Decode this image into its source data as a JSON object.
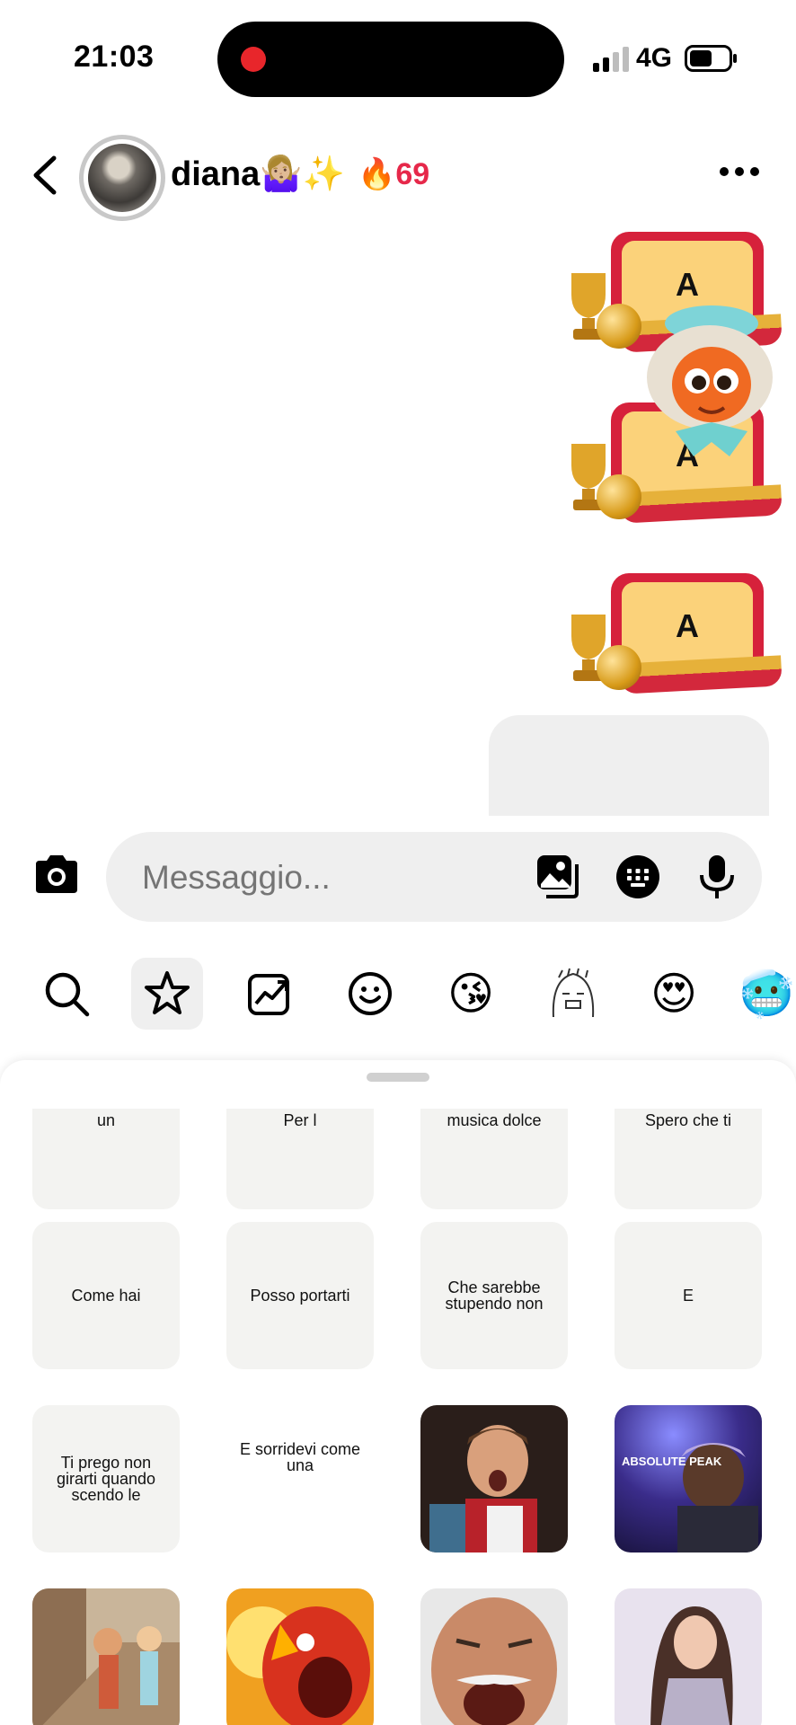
{
  "status_bar": {
    "time": "21:03",
    "network": "4G"
  },
  "header": {
    "name": "diana🤷🏼‍♀️✨",
    "streak": "🔥69"
  },
  "messages": {
    "sticker_letter": "A"
  },
  "composer": {
    "placeholder": "Messaggio..."
  },
  "icons": {
    "back": "back-arrow-icon",
    "more": "more-options-icon",
    "camera": "camera-icon",
    "gallery": "gallery-icon",
    "sticker_keyboard": "sticker-keyboard-icon",
    "mic": "microphone-icon",
    "tabs": [
      "search-icon",
      "star-icon",
      "trending-icon",
      "smiley-icon",
      "kiss-emoji-icon",
      "sketch-sticker-icon",
      "heart-eyes-emoji-icon",
      "purple-face-emoji-icon"
    ]
  },
  "tabs": {
    "kiss": "😘",
    "heart_eyes": "😍",
    "purple": "🥶"
  },
  "sticker_grid": {
    "row1": [
      "un",
      "Per l",
      "musica dolce",
      "Spero che ti"
    ],
    "row2": [
      "Come hai",
      "Posso portarti",
      "Che sarebbe stupendo non",
      "E"
    ],
    "row3": [
      "Ti prego non girarti quando scendo le",
      "E sorridevi come  una"
    ],
    "peak_caption": "ABSOLUTE PEAK"
  },
  "colors": {
    "accent_red": "#e6284a",
    "sheet_bg": "#ffffff",
    "cell_bg": "#f3f3f1",
    "pill_bg": "#efefef"
  }
}
